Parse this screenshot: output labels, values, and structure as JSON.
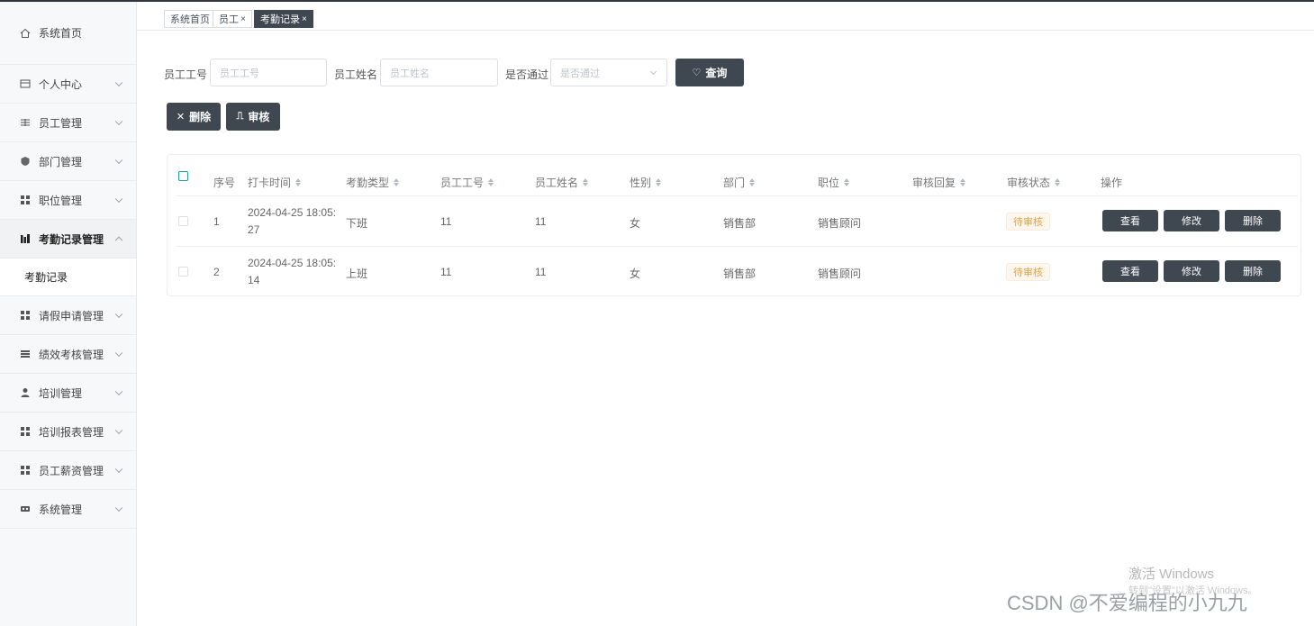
{
  "sidebar": {
    "items": [
      {
        "label": "系统首页",
        "icon": "home-icon",
        "chevron": false
      },
      {
        "label": "个人中心",
        "icon": "profile-icon",
        "chevron": true
      },
      {
        "label": "员工管理",
        "icon": "staff-icon",
        "chevron": true
      },
      {
        "label": "部门管理",
        "icon": "department-icon",
        "chevron": true
      },
      {
        "label": "职位管理",
        "icon": "grid-icon",
        "chevron": true
      },
      {
        "label": "考勤记录管理",
        "icon": "chart-icon",
        "chevron": true,
        "open": true
      },
      {
        "label": "请假申请管理",
        "icon": "grid-icon",
        "chevron": true
      },
      {
        "label": "绩效考核管理",
        "icon": "list-icon",
        "chevron": true
      },
      {
        "label": "培训管理",
        "icon": "person-icon",
        "chevron": true
      },
      {
        "label": "培训报表管理",
        "icon": "grid-icon",
        "chevron": true
      },
      {
        "label": "员工薪资管理",
        "icon": "grid-icon",
        "chevron": true
      },
      {
        "label": "系统管理",
        "icon": "settings-icon",
        "chevron": true
      }
    ],
    "submenu": {
      "label": "考勤记录"
    }
  },
  "tabs": [
    {
      "label": "系统首页",
      "closable": false
    },
    {
      "label": "员工",
      "closable": true
    },
    {
      "label": "考勤记录",
      "closable": true,
      "active": true
    }
  ],
  "search": {
    "emp_no_label": "员工工号",
    "emp_no_placeholder": "员工工号",
    "emp_name_label": "员工姓名",
    "emp_name_placeholder": "员工姓名",
    "passed_label": "是否通过",
    "passed_placeholder": "是否通过",
    "query_button": "查询"
  },
  "actions": {
    "delete_button": "删除",
    "audit_button": "审核"
  },
  "table": {
    "columns": [
      "序号",
      "打卡时间",
      "考勤类型",
      "员工工号",
      "员工姓名",
      "性别",
      "部门",
      "职位",
      "审核回复",
      "审核状态",
      "操作"
    ],
    "rows": [
      {
        "index": "1",
        "time_line1": "2024-04-25 18:05:",
        "time_line2": "27",
        "type": "下班",
        "emp_no": "11",
        "emp_name": "11",
        "gender": "女",
        "dept": "销售部",
        "position": "销售顾问",
        "reply": "",
        "status": "待审核"
      },
      {
        "index": "2",
        "time_line1": "2024-04-25 18:05:",
        "time_line2": "14",
        "type": "上班",
        "emp_no": "11",
        "emp_name": "11",
        "gender": "女",
        "dept": "销售部",
        "position": "销售顾问",
        "reply": "",
        "status": "待审核"
      }
    ],
    "row_actions": {
      "view": "查看",
      "edit": "修改",
      "delete": "删除"
    }
  },
  "watermark": {
    "windows_line1": "激活 Windows",
    "windows_line2": "转到\"设置\"以激活 Windows。",
    "csdn": "CSDN @不爱编程的小九九"
  },
  "colors": {
    "primary_dark": "#3f4750",
    "tag_warning": "#e6a23c",
    "checkbox_accent": "#1aa094"
  }
}
